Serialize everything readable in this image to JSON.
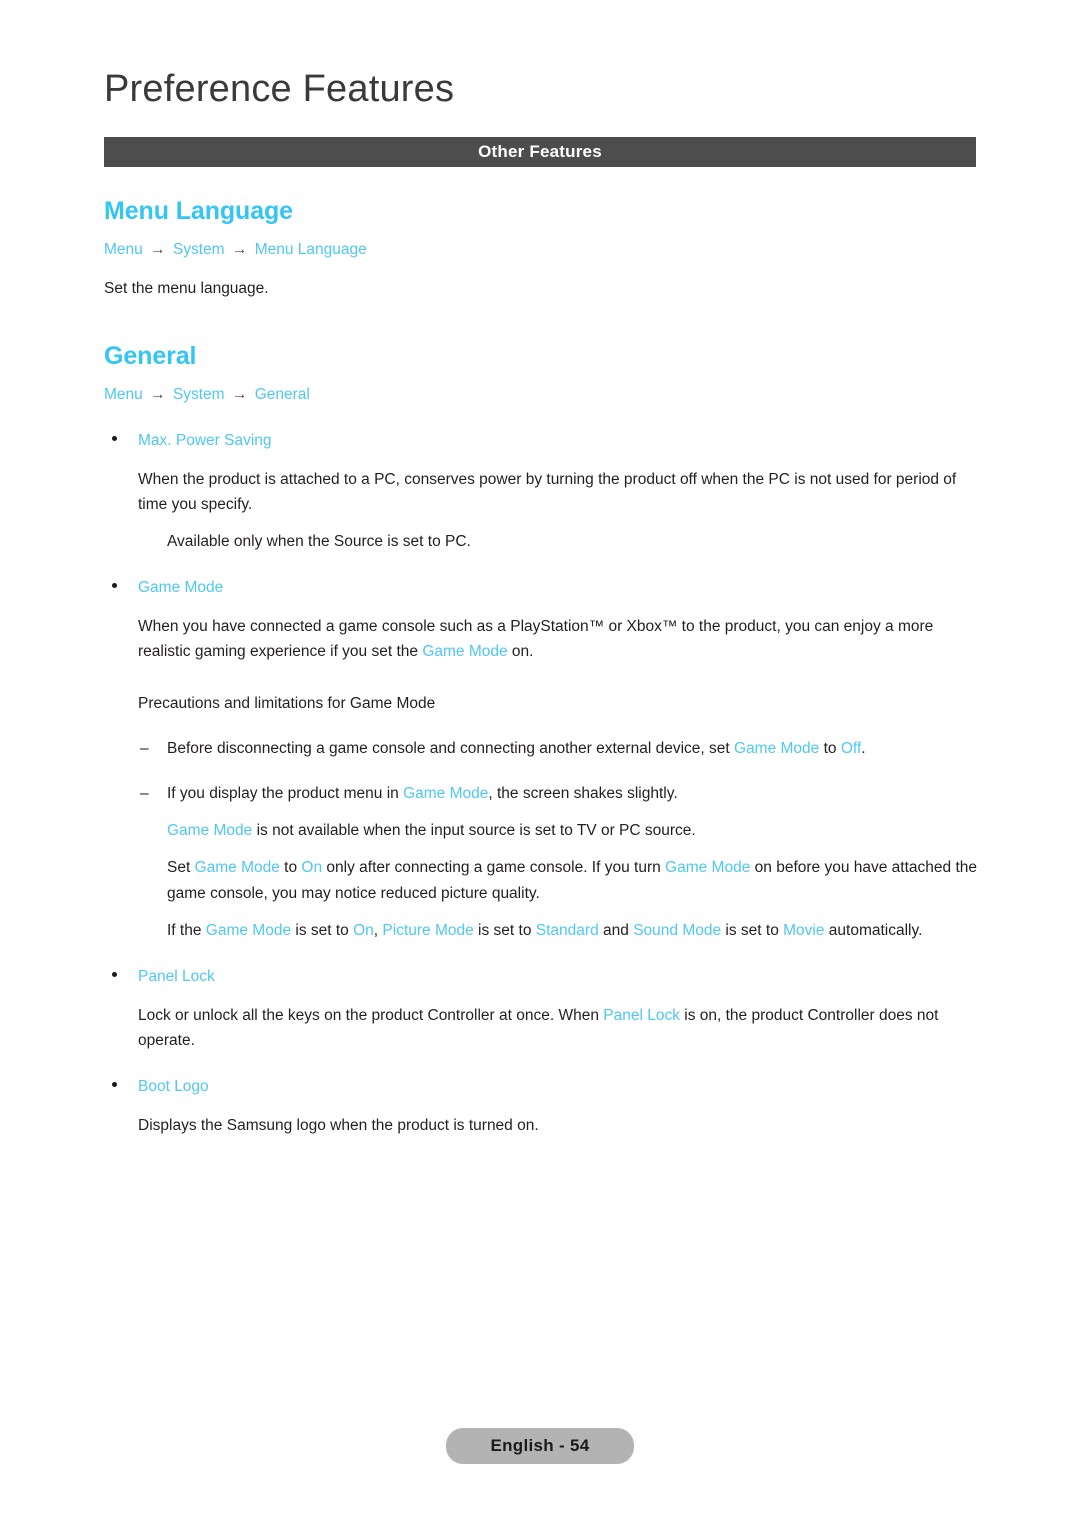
{
  "document": {
    "chapter_title": "Preference Features",
    "section_bar_label": "Other Features",
    "footer_page_label": "English - 54"
  },
  "colors": {
    "accent_cyan": "#4fc8f2",
    "heading_cyan": "#33c5f3",
    "section_bar_bg": "#4d4d4d",
    "footer_pill_bg": "#b3b3b3",
    "body_text": "#231f20"
  },
  "topics": [
    {
      "heading": "Menu Language",
      "breadcrumb": {
        "items": [
          "Menu",
          "System",
          "Menu Language"
        ],
        "separator": "→"
      },
      "description": "Set the menu language."
    },
    {
      "heading": "General",
      "breadcrumb": {
        "items": [
          "Menu",
          "System",
          "General"
        ],
        "separator": "→"
      }
    }
  ],
  "features": {
    "max_power_saving": {
      "label": "Max. Power Saving",
      "paragraph": "When the product is attached to a PC, conserves power by turning the product off when the PC is not used for period of time you specify.",
      "note": "Available only when the Source is set to PC."
    },
    "game_mode": {
      "label": "Game Mode",
      "paragraph_part1": "When you have connected a game console such as a PlayStation™ or Xbox™ to the product, you can enjoy a more realistic gaming experience if you set the ",
      "paragraph_link": "Game Mode",
      "paragraph_part2": " on.",
      "precautions_heading": "Precautions and limitations for Game Mode",
      "precautions": [
        {
          "marker": "–",
          "segments": [
            {
              "text": "Before disconnecting a game console and connecting another external device, set ",
              "highlight": false
            },
            {
              "text": "Game Mode",
              "highlight": true
            },
            {
              "text": " to ",
              "highlight": false
            },
            {
              "text": "Off",
              "highlight": true
            },
            {
              "text": ".",
              "highlight": false
            }
          ]
        },
        {
          "marker": "–",
          "segments": [
            {
              "text": "If you display the product menu in ",
              "highlight": false
            },
            {
              "text": "Game Mode",
              "highlight": true
            },
            {
              "text": ", the screen shakes slightly.",
              "highlight": false
            }
          ]
        }
      ],
      "notes": [
        {
          "segments": [
            {
              "text": "Game Mode",
              "highlight": true
            },
            {
              "text": " is not available when the input source is set to TV or PC source.",
              "highlight": false
            }
          ]
        },
        {
          "segments": [
            {
              "text": "Set ",
              "highlight": false
            },
            {
              "text": "Game Mode",
              "highlight": true
            },
            {
              "text": " to ",
              "highlight": false
            },
            {
              "text": "On",
              "highlight": true
            },
            {
              "text": " only after connecting a game console. If you turn ",
              "highlight": false
            },
            {
              "text": "Game Mode",
              "highlight": true
            },
            {
              "text": " on before you have attached the game console, you may notice reduced picture quality.",
              "highlight": false
            }
          ]
        },
        {
          "segments": [
            {
              "text": "If the ",
              "highlight": false
            },
            {
              "text": "Game Mode",
              "highlight": true
            },
            {
              "text": " is set to ",
              "highlight": false
            },
            {
              "text": "On",
              "highlight": true
            },
            {
              "text": ", ",
              "highlight": false
            },
            {
              "text": "Picture Mode",
              "highlight": true
            },
            {
              "text": " is set to ",
              "highlight": false
            },
            {
              "text": "Standard",
              "highlight": true
            },
            {
              "text": " and ",
              "highlight": false
            },
            {
              "text": "Sound Mode",
              "highlight": true
            },
            {
              "text": " is set to ",
              "highlight": false
            },
            {
              "text": "Movie",
              "highlight": true
            },
            {
              "text": " automatically.",
              "highlight": false
            }
          ]
        }
      ]
    },
    "panel_lock": {
      "label": "Panel Lock",
      "segments": [
        {
          "text": "Lock or unlock all the keys on the product Controller at once. When ",
          "highlight": false
        },
        {
          "text": "Panel Lock",
          "highlight": true
        },
        {
          "text": " is on, the product Controller does not operate.",
          "highlight": false
        }
      ]
    },
    "boot_logo": {
      "label": "Boot Logo",
      "paragraph": "Displays the Samsung logo when the product is turned on."
    }
  }
}
